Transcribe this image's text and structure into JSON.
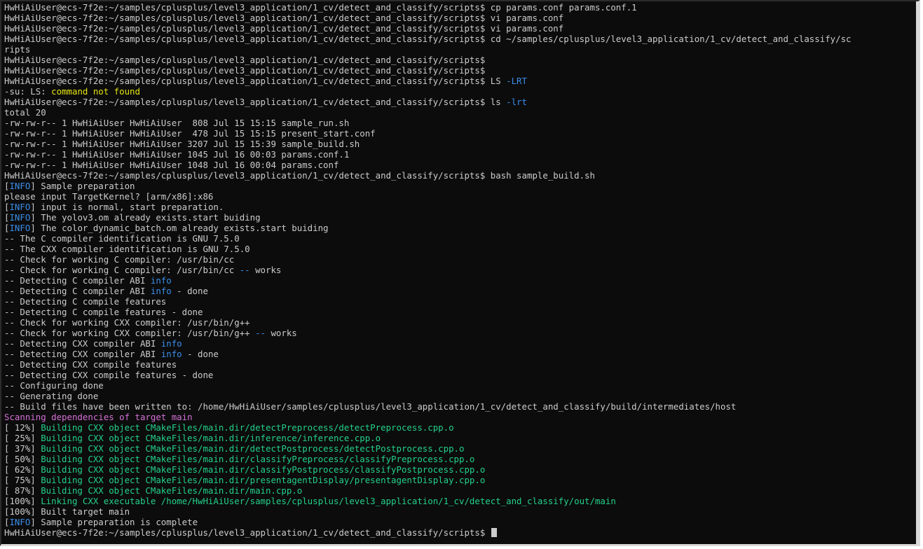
{
  "terminal": {
    "colors": {
      "background": "#0c0c0c",
      "default": "#cccccc",
      "blue": "#3b8eea",
      "yellow": "#e5e510",
      "green": "#23d18b",
      "magenta": "#d670d6"
    },
    "lines": [
      [
        {
          "t": "HwHiAiUser@ecs-7f2e:~/samples/cplusplus/level3_application/1_cv/detect_and_classify/scripts$ cp params.conf params.conf.1",
          "c": "default"
        }
      ],
      [
        {
          "t": "HwHiAiUser@ecs-7f2e:~/samples/cplusplus/level3_application/1_cv/detect_and_classify/scripts$ vi params.conf",
          "c": "default"
        }
      ],
      [
        {
          "t": "HwHiAiUser@ecs-7f2e:~/samples/cplusplus/level3_application/1_cv/detect_and_classify/scripts$ vi params.conf",
          "c": "default"
        }
      ],
      [
        {
          "t": "HwHiAiUser@ecs-7f2e:~/samples/cplusplus/level3_application/1_cv/detect_and_classify/scripts$ cd ~/samples/cplusplus/level3_application/1_cv/detect_and_classify/sc",
          "c": "default"
        }
      ],
      [
        {
          "t": "ripts",
          "c": "default"
        }
      ],
      [
        {
          "t": "HwHiAiUser@ecs-7f2e:~/samples/cplusplus/level3_application/1_cv/detect_and_classify/scripts$",
          "c": "default"
        }
      ],
      [
        {
          "t": "HwHiAiUser@ecs-7f2e:~/samples/cplusplus/level3_application/1_cv/detect_and_classify/scripts$",
          "c": "default"
        }
      ],
      [
        {
          "t": "HwHiAiUser@ecs-7f2e:~/samples/cplusplus/level3_application/1_cv/detect_and_classify/scripts$ LS ",
          "c": "default"
        },
        {
          "t": "-LRT",
          "c": "blue"
        }
      ],
      [
        {
          "t": "-su: LS: ",
          "c": "default"
        },
        {
          "t": "command not found",
          "c": "yellow"
        }
      ],
      [
        {
          "t": "HwHiAiUser@ecs-7f2e:~/samples/cplusplus/level3_application/1_cv/detect_and_classify/scripts$ ls ",
          "c": "default"
        },
        {
          "t": "-lrt",
          "c": "blue"
        }
      ],
      [
        {
          "t": "total 20",
          "c": "default"
        }
      ],
      [
        {
          "t": "-rw-rw-r-- 1 HwHiAiUser HwHiAiUser  808 Jul 15 15:15 sample_run.sh",
          "c": "default"
        }
      ],
      [
        {
          "t": "-rw-rw-r-- 1 HwHiAiUser HwHiAiUser  478 Jul 15 15:15 present_start.conf",
          "c": "default"
        }
      ],
      [
        {
          "t": "-rw-rw-r-- 1 HwHiAiUser HwHiAiUser 3207 Jul 15 15:39 sample_build.sh",
          "c": "default"
        }
      ],
      [
        {
          "t": "-rw-rw-r-- 1 HwHiAiUser HwHiAiUser 1045 Jul 16 00:03 params.conf.1",
          "c": "default"
        }
      ],
      [
        {
          "t": "-rw-rw-r-- 1 HwHiAiUser HwHiAiUser 1048 Jul 16 00:04 params.conf",
          "c": "default"
        }
      ],
      [
        {
          "t": "HwHiAiUser@ecs-7f2e:~/samples/cplusplus/level3_application/1_cv/detect_and_classify/scripts$ bash sample_build.sh",
          "c": "default"
        }
      ],
      [
        {
          "t": "[",
          "c": "default"
        },
        {
          "t": "INFO",
          "c": "blue"
        },
        {
          "t": "] Sample preparation",
          "c": "default"
        }
      ],
      [
        {
          "t": "please input TargetKernel? [arm/x86]:x86",
          "c": "default"
        }
      ],
      [
        {
          "t": "[",
          "c": "default"
        },
        {
          "t": "INFO",
          "c": "blue"
        },
        {
          "t": "] input is normal, start preparation.",
          "c": "default"
        }
      ],
      [
        {
          "t": "[",
          "c": "default"
        },
        {
          "t": "INFO",
          "c": "blue"
        },
        {
          "t": "] The yolov3.om already exists.start buiding",
          "c": "default"
        }
      ],
      [
        {
          "t": "[",
          "c": "default"
        },
        {
          "t": "INFO",
          "c": "blue"
        },
        {
          "t": "] The color_dynamic_batch.om already exists.start buiding",
          "c": "default"
        }
      ],
      [
        {
          "t": "-- The C compiler identification is GNU 7.5.0",
          "c": "default"
        }
      ],
      [
        {
          "t": "-- The CXX compiler identification is GNU 7.5.0",
          "c": "default"
        }
      ],
      [
        {
          "t": "-- Check for working C compiler: /usr/bin/cc",
          "c": "default"
        }
      ],
      [
        {
          "t": "-- Check for working C compiler: /usr/bin/cc ",
          "c": "default"
        },
        {
          "t": "--",
          "c": "blue"
        },
        {
          "t": " works",
          "c": "default"
        }
      ],
      [
        {
          "t": "-- Detecting C compiler ABI ",
          "c": "default"
        },
        {
          "t": "info",
          "c": "blue"
        }
      ],
      [
        {
          "t": "-- Detecting C compiler ABI ",
          "c": "default"
        },
        {
          "t": "info",
          "c": "blue"
        },
        {
          "t": " - done",
          "c": "default"
        }
      ],
      [
        {
          "t": "-- Detecting C compile features",
          "c": "default"
        }
      ],
      [
        {
          "t": "-- Detecting C compile features - done",
          "c": "default"
        }
      ],
      [
        {
          "t": "-- Check for working CXX compiler: /usr/bin/g++",
          "c": "default"
        }
      ],
      [
        {
          "t": "-- Check for working CXX compiler: /usr/bin/g++ ",
          "c": "default"
        },
        {
          "t": "--",
          "c": "blue"
        },
        {
          "t": " works",
          "c": "default"
        }
      ],
      [
        {
          "t": "-- Detecting CXX compiler ABI ",
          "c": "default"
        },
        {
          "t": "info",
          "c": "blue"
        }
      ],
      [
        {
          "t": "-- Detecting CXX compiler ABI ",
          "c": "default"
        },
        {
          "t": "info",
          "c": "blue"
        },
        {
          "t": " - done",
          "c": "default"
        }
      ],
      [
        {
          "t": "-- Detecting CXX compile features",
          "c": "default"
        }
      ],
      [
        {
          "t": "-- Detecting CXX compile features - done",
          "c": "default"
        }
      ],
      [
        {
          "t": "-- Configuring done",
          "c": "default"
        }
      ],
      [
        {
          "t": "-- Generating done",
          "c": "default"
        }
      ],
      [
        {
          "t": "-- Build files have been written to: /home/HwHiAiUser/samples/cplusplus/level3_application/1_cv/detect_and_classify/build/intermediates/host",
          "c": "default"
        }
      ],
      [
        {
          "t": "Scanning dependencies of target main",
          "c": "magenta"
        }
      ],
      [
        {
          "t": "[ 12%] ",
          "c": "default"
        },
        {
          "t": "Building CXX object CMakeFiles/main.dir/detectPreprocess/detectPreprocess.cpp.o",
          "c": "green"
        }
      ],
      [
        {
          "t": "[ 25%] ",
          "c": "default"
        },
        {
          "t": "Building CXX object CMakeFiles/main.dir/inference/inference.cpp.o",
          "c": "green"
        }
      ],
      [
        {
          "t": "[ 37%] ",
          "c": "default"
        },
        {
          "t": "Building CXX object CMakeFiles/main.dir/detectPostprocess/detectPostprocess.cpp.o",
          "c": "green"
        }
      ],
      [
        {
          "t": "[ 50%] ",
          "c": "default"
        },
        {
          "t": "Building CXX object CMakeFiles/main.dir/classifyPreprocess/classifyPreprocess.cpp.o",
          "c": "green"
        }
      ],
      [
        {
          "t": "[ 62%] ",
          "c": "default"
        },
        {
          "t": "Building CXX object CMakeFiles/main.dir/classifyPostprocess/classifyPostprocess.cpp.o",
          "c": "green"
        }
      ],
      [
        {
          "t": "[ 75%] ",
          "c": "default"
        },
        {
          "t": "Building CXX object CMakeFiles/main.dir/presentagentDisplay/presentagentDisplay.cpp.o",
          "c": "green"
        }
      ],
      [
        {
          "t": "[ 87%] ",
          "c": "default"
        },
        {
          "t": "Building CXX object CMakeFiles/main.dir/main.cpp.o",
          "c": "green"
        }
      ],
      [
        {
          "t": "[100%] ",
          "c": "default"
        },
        {
          "t": "Linking CXX executable /home/HwHiAiUser/samples/cplusplus/level3_application/1_cv/detect_and_classify/out/main",
          "c": "green"
        }
      ],
      [
        {
          "t": "[100%] Built target main",
          "c": "default"
        }
      ],
      [
        {
          "t": "[",
          "c": "default"
        },
        {
          "t": "INFO",
          "c": "blue"
        },
        {
          "t": "] Sample preparation is complete",
          "c": "default"
        }
      ],
      [
        {
          "t": "HwHiAiUser@ecs-7f2e:~/samples/cplusplus/level3_application/1_cv/detect_and_classify/scripts$ ",
          "c": "default"
        }
      ]
    ]
  }
}
